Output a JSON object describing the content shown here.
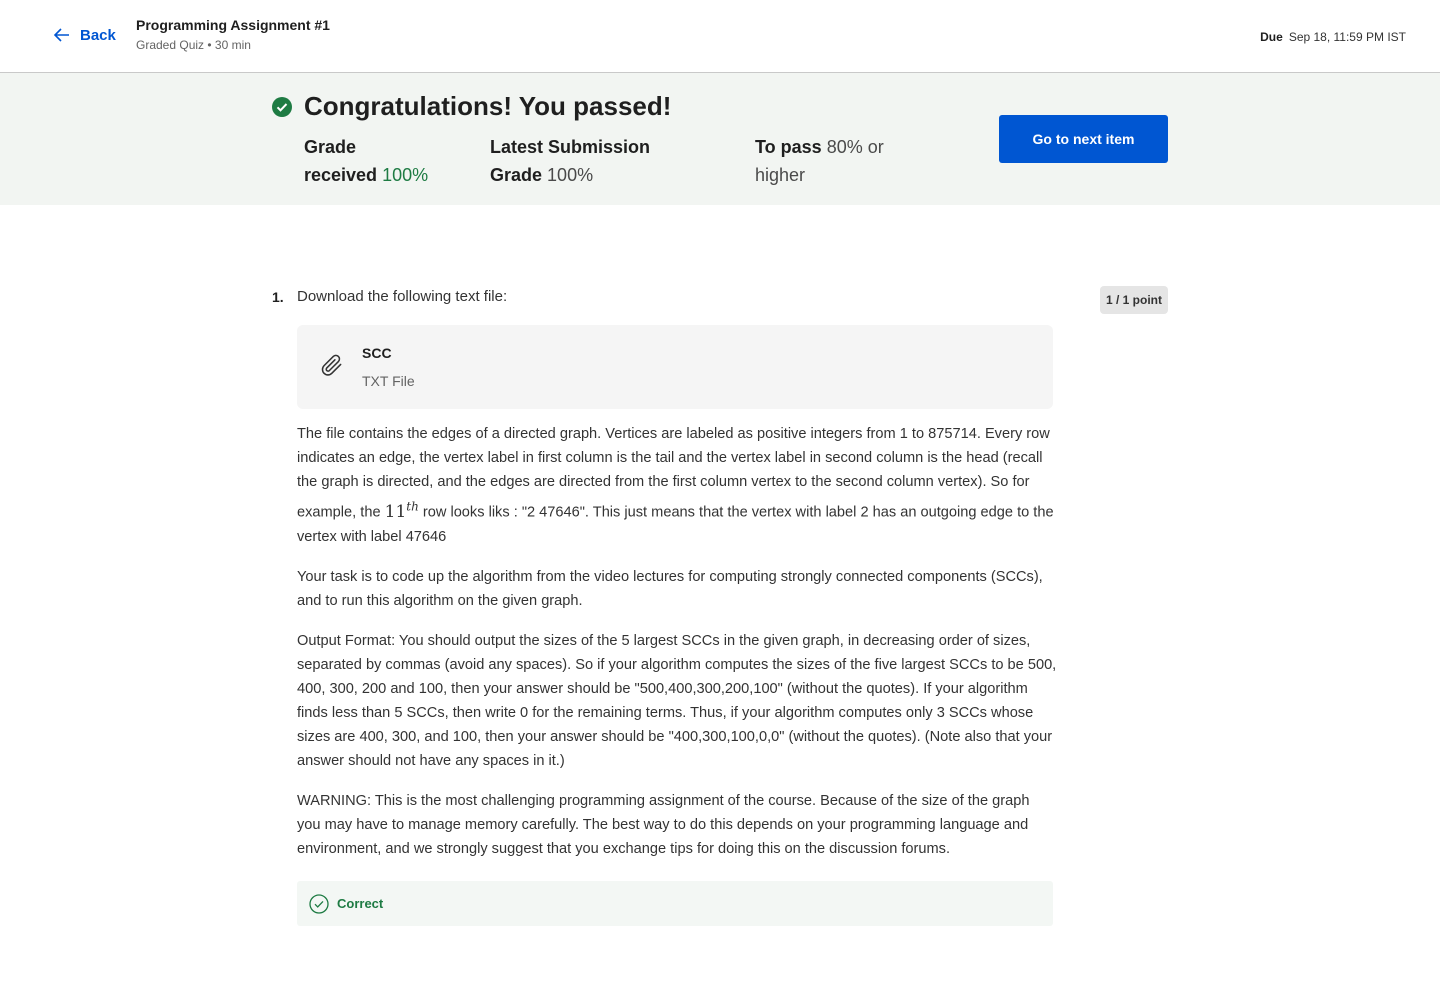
{
  "header": {
    "back_label": "Back",
    "title": "Programming Assignment #1",
    "subtitle": "Graded Quiz • 30 min",
    "due_label": "Due",
    "due_value": "Sep 18, 11:59 PM IST"
  },
  "banner": {
    "headline": "Congratulations! You passed!",
    "grade_label_1": "Grade",
    "grade_label_2": "received",
    "grade_value": "100%",
    "latest_label_1": "Latest Submission",
    "latest_label_2": "Grade",
    "latest_value": "100%",
    "pass_label": "To pass",
    "pass_value": "80% or higher",
    "next_button": "Go to next item",
    "colors": {
      "success": "#1e7b43",
      "primary": "#0056d2",
      "banner_bg": "#f2f5f2"
    }
  },
  "question": {
    "number": "1.",
    "prompt": "Download the following text file:",
    "points": "1 / 1 point",
    "file": {
      "name": "SCC",
      "type": "TXT File",
      "icon": "paperclip-icon"
    },
    "para1_a": "The file contains the edges of a directed graph. Vertices are labeled as positive integers from 1 to 875714. Every row indicates an edge, the vertex label in first column is the tail and the vertex label in second column is the head (recall the graph is directed, and the edges are directed from the first column vertex to the second column vertex). So for example, the ",
    "para1_math_base": "11",
    "para1_math_sup": "th",
    "para1_b": " row looks liks : \"2 47646\". This just means that the vertex with label 2 has an outgoing edge to the vertex with label 47646",
    "para2": "Your task is to code up the algorithm from the video lectures for computing strongly connected components (SCCs), and to run this algorithm on the given graph.",
    "para3": "Output Format: You should output the sizes of the 5 largest SCCs in the given graph, in decreasing order of sizes, separated by commas (avoid any spaces). So if your algorithm computes the sizes of the five largest SCCs to be 500, 400, 300, 200 and 100, then your answer should be \"500,400,300,200,100\" (without the quotes). If your algorithm finds less than 5 SCCs, then write 0 for the remaining terms. Thus, if your algorithm computes only 3 SCCs whose sizes are 400, 300, and 100, then your answer should be \"400,300,100,0,0\" (without the quotes). (Note also that your answer should not have any spaces in it.)",
    "para4": "WARNING: This is the most challenging programming assignment of the course. Because of the size of the graph you may have to manage memory carefully. The best way to do this depends on your programming language and environment, and we strongly suggest that you exchange tips for doing this on the discussion forums.",
    "feedback": "Correct"
  }
}
